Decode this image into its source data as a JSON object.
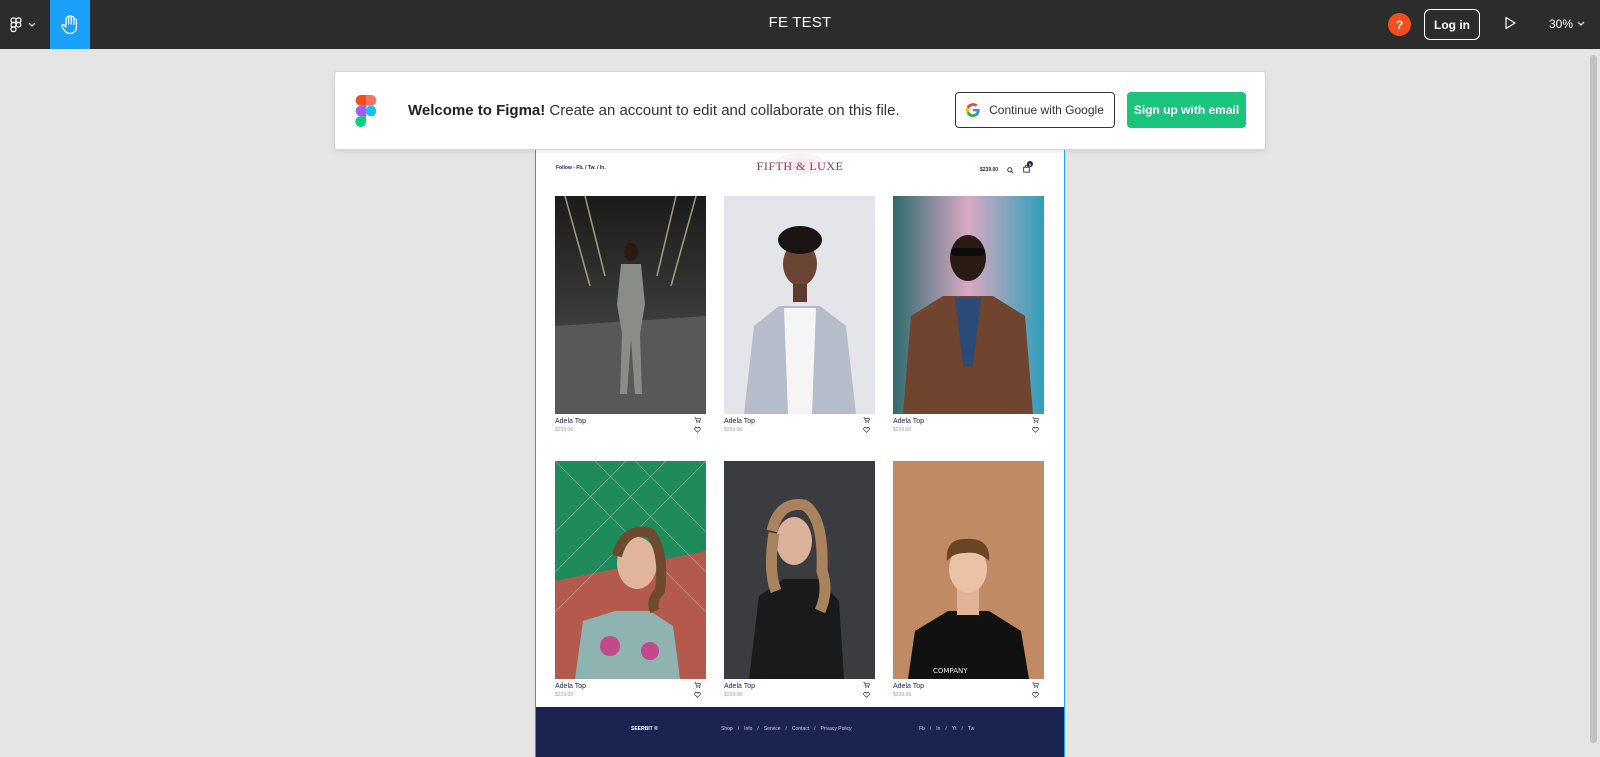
{
  "toolbar": {
    "file_title": "FE TEST",
    "help_label": "?",
    "login_label": "Log in",
    "zoom_label": "30%",
    "hand_color": "#18a0fb"
  },
  "banner": {
    "welcome_bold": "Welcome to Figma!",
    "welcome_rest": " Create an account to edit and collaborate on this file.",
    "google_label": "Continue with Google",
    "email_label": "Sign up with email"
  },
  "site": {
    "follow": "Follow - Fb. / Tw. / In.",
    "brand": "FIFTH & LUXE",
    "cart_total": "$239.00",
    "cart_count": "0",
    "products": [
      {
        "name": "Adela Top",
        "price": "$239.00"
      },
      {
        "name": "Adela Top",
        "price": "$239.00"
      },
      {
        "name": "Adela Top",
        "price": "$239.00"
      },
      {
        "name": "Adela Top",
        "price": "$239.00"
      },
      {
        "name": "Adela Top",
        "price": "$239.00"
      },
      {
        "name": "Adela Top",
        "price": "$239.00"
      }
    ],
    "footer": {
      "brand": "SEERBIT ®",
      "links": [
        "Shop",
        "/",
        "Info",
        "/",
        "Service",
        "/",
        "Contact",
        "/",
        "Privacy Policy"
      ],
      "social": [
        "Fb",
        "/",
        "In",
        "/",
        "Yt",
        "/",
        "Tw"
      ]
    }
  }
}
